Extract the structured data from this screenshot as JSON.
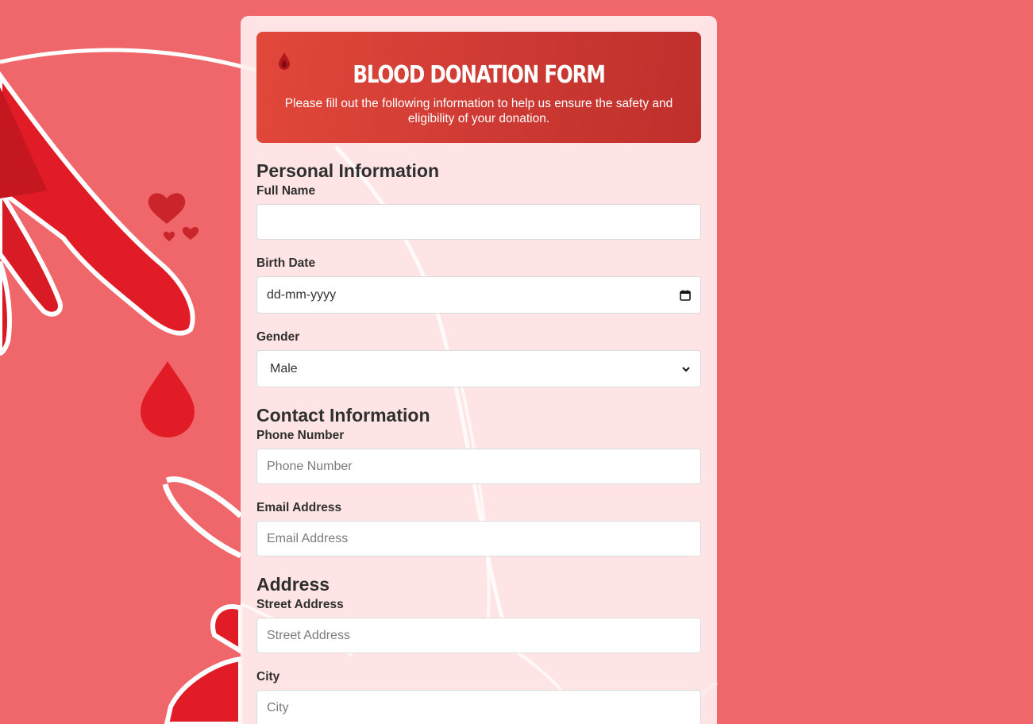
{
  "header": {
    "title": "Blood Donation Form",
    "subtitle": "Please fill out the following information to help us ensure the safety and eligibility of your donation.",
    "icon": "blood-drop-icon"
  },
  "sections": {
    "personal": {
      "title": "Personal Information",
      "full_name_label": "Full Name",
      "full_name_value": "",
      "birth_date_label": "Birth Date",
      "birth_date_placeholder": "dd-mm-yyyy",
      "gender_label": "Gender",
      "gender_value": "Male"
    },
    "contact": {
      "title": "Contact Information",
      "phone_label": "Phone Number",
      "phone_placeholder": "Phone Number",
      "email_label": "Email Address",
      "email_placeholder": "Email Address"
    },
    "address": {
      "title": "Address",
      "street_label": "Street Address",
      "street_placeholder": "Street Address",
      "city_label": "City",
      "city_placeholder": "City"
    }
  },
  "colors": {
    "background": "#ef676a",
    "banner_start": "#e2483a",
    "banner_end": "#bf2f2b",
    "card": "#ffeeee",
    "accent_red": "#d81e26"
  }
}
